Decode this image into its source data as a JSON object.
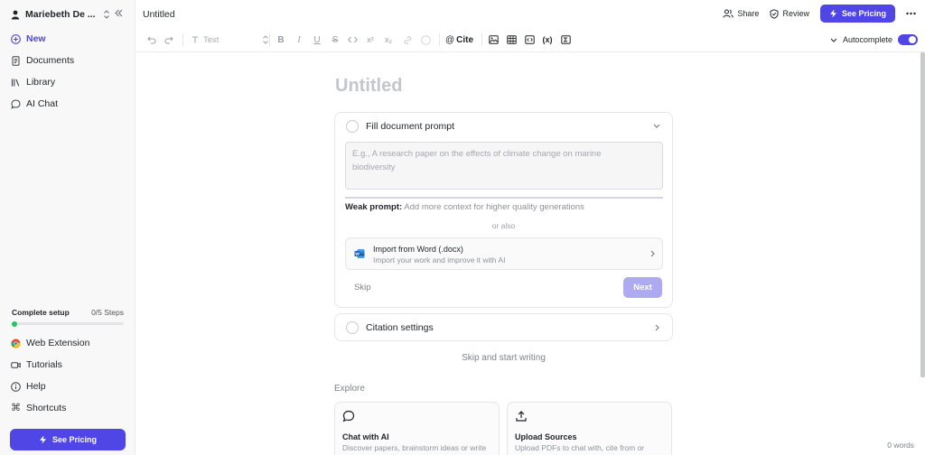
{
  "sidebar": {
    "workspace_name": "Mariebeth De ...",
    "nav": {
      "new": "New",
      "documents": "Documents",
      "library": "Library",
      "ai_chat": "AI Chat"
    },
    "setup": {
      "label": "Complete setup",
      "steps": "0/5 Steps",
      "progress": 0
    },
    "bottom": {
      "web_extension": "Web Extension",
      "tutorials": "Tutorials",
      "help": "Help",
      "shortcuts": "Shortcuts"
    },
    "pricing": "See Pricing"
  },
  "header": {
    "doc_title": "Untitled",
    "share": "Share",
    "review": "Review",
    "pricing": "See Pricing"
  },
  "toolbar": {
    "text_style": "Text",
    "cite": "Cite",
    "autocomplete": "Autocomplete",
    "autocomplete_on": true
  },
  "editor": {
    "title_placeholder": "Untitled",
    "prompt_card": {
      "title": "Fill document prompt",
      "placeholder_line1": "E.g., A research paper on the effects of climate change on marine",
      "placeholder_line2": "biodiversity",
      "weak_label": "Weak prompt:",
      "weak_text": "Add more context for higher quality generations",
      "or_also": "or also",
      "import_title": "Import from Word (.docx)",
      "import_sub": "Import your work and improve it with AI",
      "skip": "Skip",
      "next": "Next"
    },
    "citation_card": {
      "title": "Citation settings"
    },
    "skip_write": "Skip and start writing",
    "explore": {
      "label": "Explore",
      "cards": [
        {
          "title": "Chat with AI",
          "desc": "Discover papers, brainstorm ideas or write"
        },
        {
          "title": "Upload Sources",
          "desc": "Upload PDFs to chat with, cite from or"
        }
      ]
    },
    "word_count": "0 words"
  },
  "colors": {
    "accent": "#4f46e5",
    "success": "#22c55e"
  }
}
